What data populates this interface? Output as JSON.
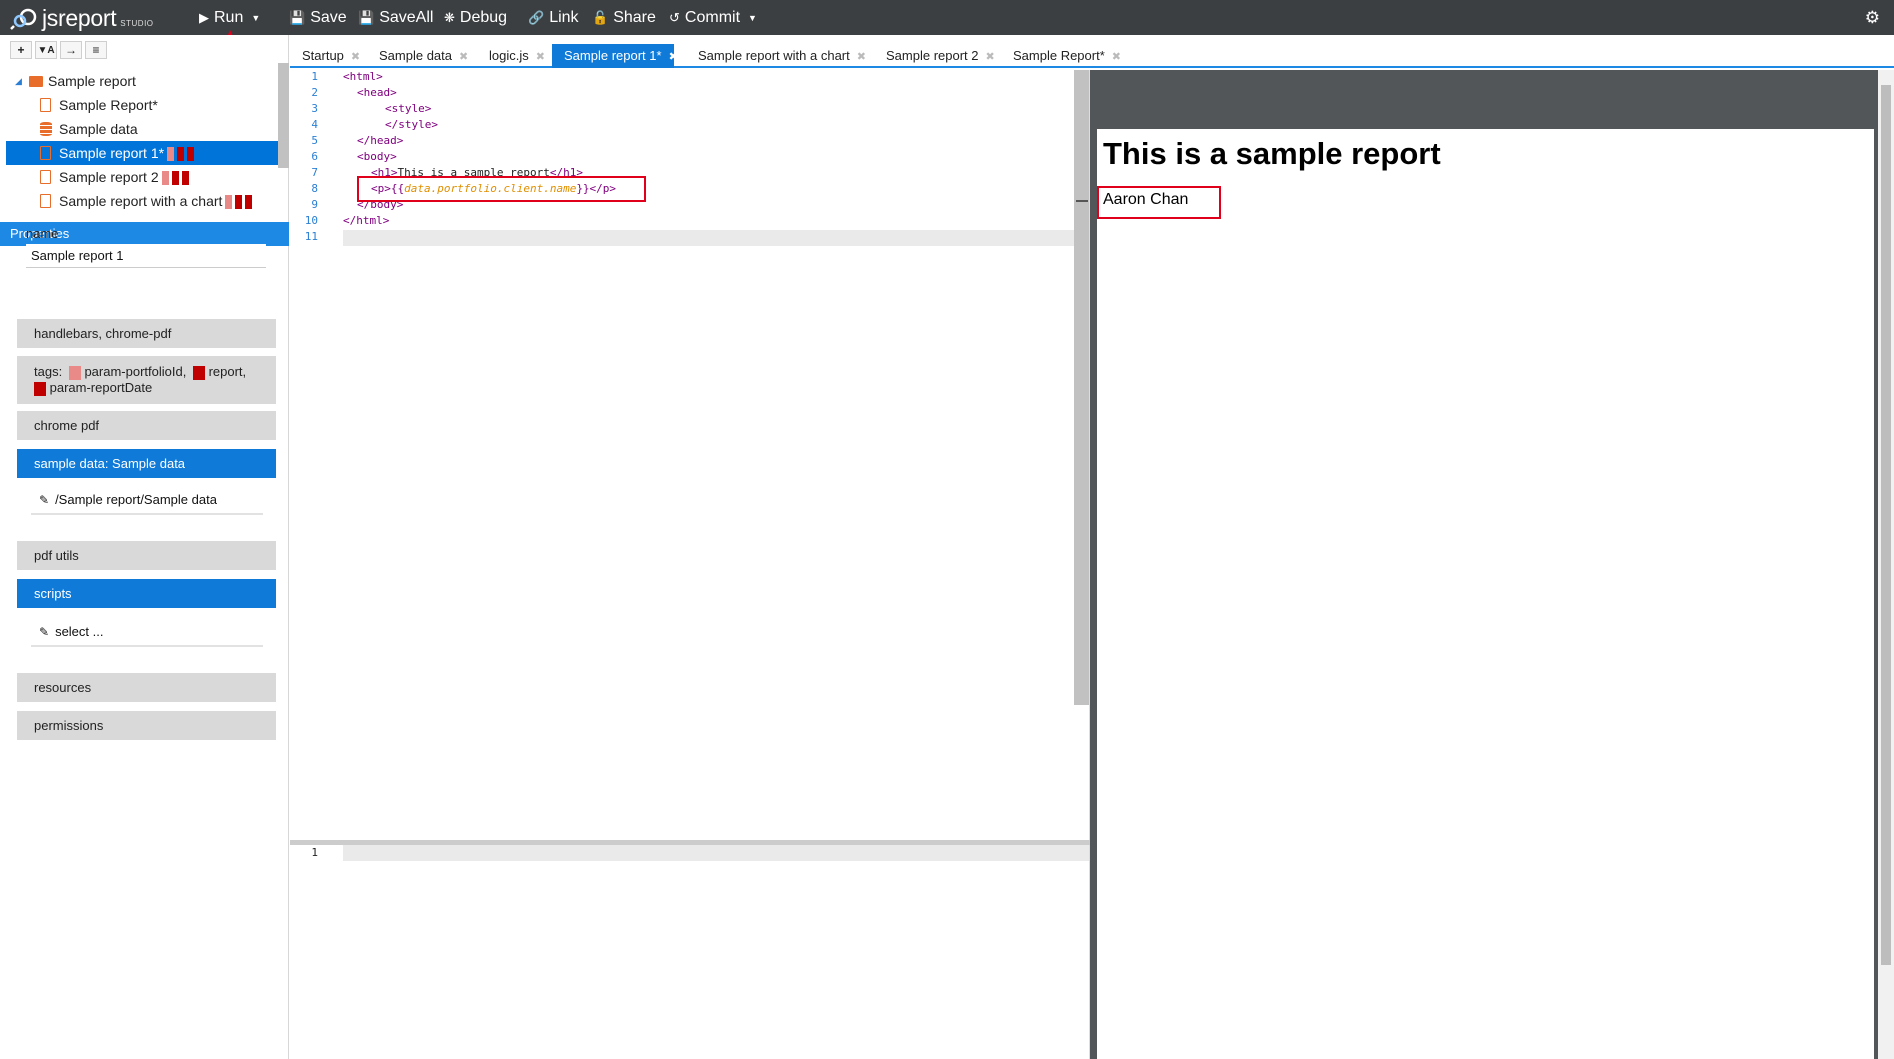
{
  "app": {
    "logo_text": "jsreport",
    "logo_studio": "STUDIO"
  },
  "toolbar": {
    "run": "Run",
    "save": "Save",
    "save_all": "SaveAll",
    "debug": "Debug",
    "link": "Link",
    "share": "Share",
    "commit": "Commit"
  },
  "tree": {
    "toolbar_icons": [
      "plus-icon",
      "filter-icon",
      "arrow-icon",
      "menu-icon"
    ],
    "folder": "Sample report",
    "items": [
      {
        "label": "Sample Report*",
        "icon": "document-icon"
      },
      {
        "label": "Sample data",
        "icon": "database-icon"
      },
      {
        "label": "Sample report 1*",
        "icon": "document-icon",
        "selected": true
      },
      {
        "label": "Sample report 2",
        "icon": "document-icon"
      },
      {
        "label": "Sample report with a chart",
        "icon": "document-icon"
      }
    ]
  },
  "properties": {
    "header": "Properties",
    "name_label": "name",
    "name_value": "Sample report 1",
    "engine_recipe": "handlebars, chrome-pdf",
    "tags_label": "tags:",
    "tag1": "param-portfolioId,",
    "tag2": "report,",
    "tag3": "param-reportDate",
    "chrome_pdf": "chrome pdf",
    "sample_data": "sample data: Sample data",
    "sample_data_link": "/Sample report/Sample data",
    "pdf_utils": "pdf utils",
    "scripts": "scripts",
    "scripts_select": "select ...",
    "resources": "resources",
    "permissions": "permissions"
  },
  "tabs": [
    {
      "label": "Startup",
      "active": false
    },
    {
      "label": "Sample data",
      "active": false
    },
    {
      "label": "logic.js",
      "active": false
    },
    {
      "label": "Sample report 1*",
      "active": true
    },
    {
      "label": "Sample report with a chart",
      "active": false
    },
    {
      "label": "Sample report 2",
      "active": false
    },
    {
      "label": "Sample Report*",
      "active": false
    }
  ],
  "editor": {
    "line_numbers": [
      "1",
      "2",
      "3",
      "4",
      "5",
      "6",
      "7",
      "8",
      "9",
      "10",
      "11"
    ],
    "l1": "<html>",
    "l2": "<head>",
    "l3": "<style>",
    "l4": "</style>",
    "l5": "</head>",
    "l6": "<body>",
    "l7_open": "<h1>",
    "l7_text": "This is a sample report",
    "l7_close": "</h1>",
    "l8_open": "<p>{{",
    "l8_expr": "data.portfolio.client.name",
    "l8_close": "}}</p>",
    "l9": "</body>",
    "l10": "</html>",
    "helpers_line": "1"
  },
  "preview": {
    "heading": "This is a sample report",
    "client_name": "Aaron Chan"
  },
  "colors": {
    "accent": "#0f7ad8",
    "topbar": "#3c3f41",
    "highlight_box": "#e0001b",
    "tag_pink": "#e98a88",
    "tag_red": "#c00000"
  }
}
